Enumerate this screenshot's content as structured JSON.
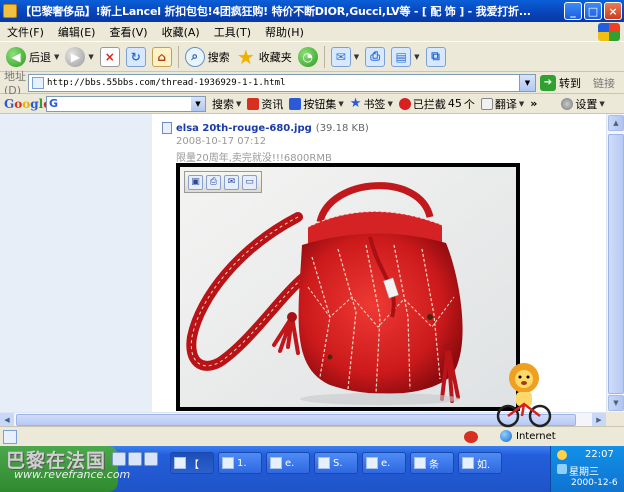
{
  "window": {
    "title": "【巴黎奢侈品】!新上Lancel 折扣包包!4团疯狂购! 特价不断DIOR,Gucci,LV等 - [ 配 饰 ] - 我爱打折...",
    "buttons": {
      "minimize": "_",
      "maximize": "□",
      "close": "×"
    }
  },
  "menu": {
    "items": [
      "文件(F)",
      "编辑(E)",
      "查看(V)",
      "收藏(A)",
      "工具(T)",
      "帮助(H)"
    ]
  },
  "toolbar": {
    "back_label": "后退",
    "search_label": "搜索",
    "favorites_label": "收藏夹"
  },
  "address": {
    "label": "地址(D)",
    "url": "http://bbs.55bbs.com/thread-1936929-1-1.html",
    "go_label": "转到",
    "links_label": "链接"
  },
  "google": {
    "logo": [
      "G",
      "o",
      "o",
      "g",
      "l",
      "e"
    ],
    "search_prefix": "G",
    "search_label": "搜索",
    "news_label": "资讯",
    "buttons_label": "按钮集",
    "bookmarks_label": "书签",
    "blocked_label": "已拦截",
    "blocked_count": "45",
    "translate_label": "翻译",
    "settings_label": "设置"
  },
  "post": {
    "file_name": "elsa 20th-rouge-680.jpg",
    "file_size": "(39.18 KB)",
    "date": "2008-10-17 07:12",
    "description": "限量20周年,卖完就没!!!6800RMB"
  },
  "status": {
    "zone_label": "Internet"
  },
  "taskbar": {
    "watermark": "巴黎在法国",
    "watermark_url": "www.revefrance.com",
    "tasks": [
      "【",
      "1.",
      "e.",
      "S.",
      "e.",
      "条",
      "如.",
      "【"
    ],
    "clock_time": "22:07",
    "clock_weekday": "星期三",
    "clock_date": "2000-12-6"
  },
  "colors": {
    "title_bar": "#0843b8",
    "bag_red": "#d21c1e",
    "link_blue": "#1a3aa8",
    "taskbar_blue": "#245edb"
  }
}
